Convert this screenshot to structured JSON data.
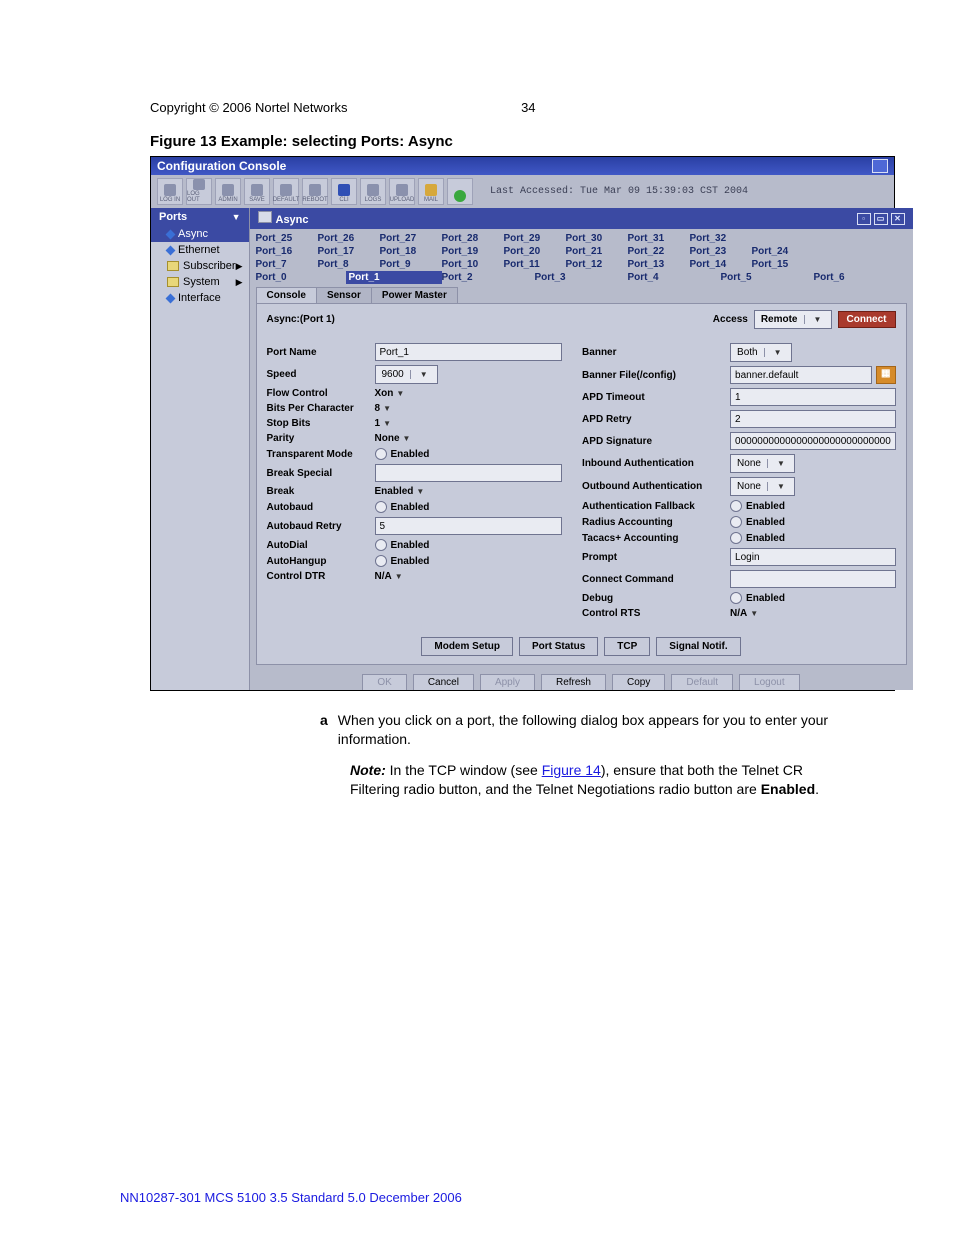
{
  "header": {
    "copyright": "Copyright © 2006 Nortel Networks",
    "page": "34"
  },
  "figure_caption": "Figure 13  Example: selecting Ports: Async",
  "titlebar": "Configuration Console",
  "toolbar": {
    "icons": [
      "LOG IN",
      "LOG OUT",
      "ADMIN",
      "SAVE",
      "DEFAULT",
      "REBOOT",
      "CLI",
      "LOGS",
      "UPLOAD",
      "MAIL",
      ""
    ],
    "timestamp": "Last Accessed: Tue Mar 09 15:39:03 CST 2004"
  },
  "nav": {
    "header": "Ports",
    "items": [
      {
        "label": "Async",
        "icon": "dia",
        "sel": true
      },
      {
        "label": "Ethernet",
        "icon": "dia"
      },
      {
        "label": "Subscriber",
        "icon": "fold",
        "arrow": true
      },
      {
        "label": "System",
        "icon": "fold",
        "arrow": true
      },
      {
        "label": "Interface",
        "icon": "dia"
      }
    ]
  },
  "pane_title": "Async",
  "ports": {
    "r1": [
      "Port_25",
      "Port_26",
      "Port_27",
      "Port_28",
      "Port_29",
      "Port_30",
      "Port_31",
      "Port_32"
    ],
    "r2": [
      "Port_16",
      "Port_17",
      "Port_18",
      "Port_19",
      "Port_20",
      "Port_21",
      "Port_22",
      "Port_23",
      "Port_24"
    ],
    "r3": [
      "Port_7",
      "Port_8",
      "Port_9",
      "Port_10",
      "Port_11",
      "Port_12",
      "Port_13",
      "Port_14",
      "Port_15"
    ],
    "r4": [
      "Port_0",
      "Port_1",
      "Port_2",
      "Port_3",
      "Port_4",
      "Port_5",
      "Port_6"
    ]
  },
  "tabs": [
    "Console",
    "Sensor",
    "Power Master"
  ],
  "panel": {
    "title": "Async:(Port 1)",
    "access_label": "Access",
    "access_value": "Remote",
    "connect": "Connect",
    "left": [
      {
        "l": "Port Name",
        "t": "text",
        "v": "Port_1"
      },
      {
        "l": "Speed",
        "t": "ddv",
        "v": "9600"
      },
      {
        "l": "Flow Control",
        "t": "dd",
        "v": "Xon"
      },
      {
        "l": "Bits Per Character",
        "t": "dd",
        "v": "8"
      },
      {
        "l": "Stop Bits",
        "t": "dd",
        "v": "1"
      },
      {
        "l": "Parity",
        "t": "dd",
        "v": "None"
      },
      {
        "l": "Transparent Mode",
        "t": "rad",
        "v": "Enabled"
      },
      {
        "l": "Break Special",
        "t": "text",
        "v": ""
      },
      {
        "l": "Break",
        "t": "dd",
        "v": "Enabled"
      },
      {
        "l": "Autobaud",
        "t": "rad",
        "v": "Enabled"
      },
      {
        "l": "Autobaud Retry",
        "t": "text",
        "v": "5"
      },
      {
        "l": "AutoDial",
        "t": "rad",
        "v": "Enabled"
      },
      {
        "l": "AutoHangup",
        "t": "rad",
        "v": "Enabled"
      },
      {
        "l": "Control DTR",
        "t": "dd",
        "v": "N/A"
      }
    ],
    "right": [
      {
        "l": "Banner",
        "t": "ddv",
        "v": "Both"
      },
      {
        "l": "Banner File(/config)",
        "t": "textbtn",
        "v": "banner.default"
      },
      {
        "l": "APD Timeout",
        "t": "text",
        "v": "1"
      },
      {
        "l": "APD Retry",
        "t": "text",
        "v": "2"
      },
      {
        "l": "APD Signature",
        "t": "text",
        "v": "000000000000000000000000000000"
      },
      {
        "l": "Inbound Authentication",
        "t": "ddv",
        "v": "None"
      },
      {
        "l": "Outbound Authentication",
        "t": "ddv",
        "v": "None"
      },
      {
        "l": "Authentication Fallback",
        "t": "rad",
        "v": "Enabled"
      },
      {
        "l": "Radius Accounting",
        "t": "rad",
        "v": "Enabled"
      },
      {
        "l": "Tacacs+ Accounting",
        "t": "rad",
        "v": "Enabled"
      },
      {
        "l": "Prompt",
        "t": "text",
        "v": "Login"
      },
      {
        "l": "Connect Command",
        "t": "text",
        "v": ""
      },
      {
        "l": "Debug",
        "t": "rad",
        "v": "Enabled"
      },
      {
        "l": "Control RTS",
        "t": "dd",
        "v": "N/A"
      }
    ],
    "subbtns": [
      "Modem Setup",
      "Port Status",
      "TCP",
      "Signal Notif."
    ]
  },
  "footbtns": [
    {
      "l": "OK",
      "dis": true
    },
    {
      "l": "Cancel"
    },
    {
      "l": "Apply",
      "dis": true
    },
    {
      "l": "Refresh"
    },
    {
      "l": "Copy"
    },
    {
      "l": "Default",
      "dis": true
    },
    {
      "l": "Logout",
      "dis": true
    }
  ],
  "caption": {
    "letter": "a",
    "text": "When you click on a port, the following dialog box appears for you to enter your information.",
    "note_label": "Note:",
    "note_before": "  In the TCP window (see ",
    "note_link": "Figure 14",
    "note_after": "), ensure that both the Telnet CR Filtering radio button, and the Telnet Negotiations radio button are ",
    "note_bold": "Enabled",
    "note_end": "."
  },
  "footer": "NN10287-301   MCS 5100 3.5   Standard   5.0   December 2006"
}
